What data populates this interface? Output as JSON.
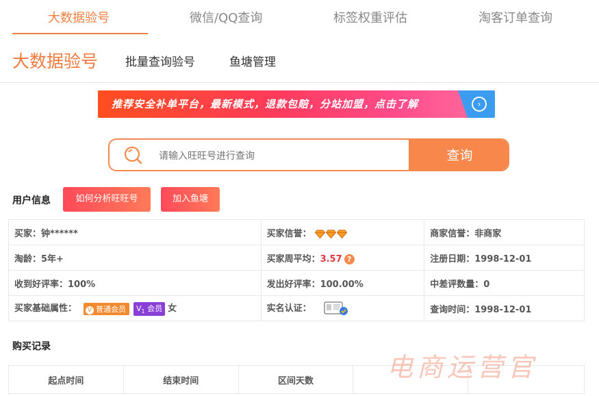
{
  "top_tabs": [
    {
      "label": "大数据验号",
      "active": true
    },
    {
      "label": "微信/QQ查询",
      "active": false
    },
    {
      "label": "标签权重评估",
      "active": false
    },
    {
      "label": "淘客订单查询",
      "active": false
    }
  ],
  "sub_nav": {
    "title": "大数据验号",
    "links": [
      "批量查询验号",
      "鱼塘管理"
    ]
  },
  "banner": {
    "text": "推荐安全补单平台，最新模式，退款包赔，分站加盟，点击了解",
    "arrow_icon": "arrow-right-circle-icon"
  },
  "search": {
    "placeholder": "请输入旺旺号进行查询",
    "button_label": "查询"
  },
  "user_info": {
    "title": "用户信息",
    "buttons": [
      "如何分析旺旺号",
      "加入鱼塘"
    ],
    "rows": [
      [
        {
          "label": "买家：",
          "value": "钟******"
        },
        {
          "label": "买家信誉：",
          "value": "",
          "icon": "diamond-icon",
          "count": 3
        },
        {
          "label": "商家信誉：",
          "value": "非商家"
        }
      ],
      [
        {
          "label": "淘龄：",
          "value": "5年+"
        },
        {
          "label": "买家周平均：",
          "value": "3.57",
          "icon": "question-icon"
        },
        {
          "label": "注册日期：",
          "value": "1998-12-01"
        }
      ],
      [
        {
          "label": "收到好评率：",
          "value": "100%"
        },
        {
          "label": "发出好评率：",
          "value": "100.00%"
        },
        {
          "label": "中差评数量：",
          "value": "0"
        }
      ],
      [
        {
          "label": "买家基础属性：",
          "badge1": "普通会员",
          "badge2": "会员",
          "gender": "女"
        },
        {
          "label": "实名认证：",
          "icon": "id-card-icon"
        },
        {
          "label": "查询时间：",
          "value": "1998-12-01"
        }
      ]
    ]
  },
  "purchase_records": {
    "title": "购买记录",
    "columns": [
      "起点时间",
      "结束时间",
      "区间天数",
      "",
      ""
    ]
  },
  "watermark": "电商运营官",
  "colors": {
    "accent": "#f07a3e",
    "red": "#e0383e",
    "purple": "#8a3fd6"
  }
}
